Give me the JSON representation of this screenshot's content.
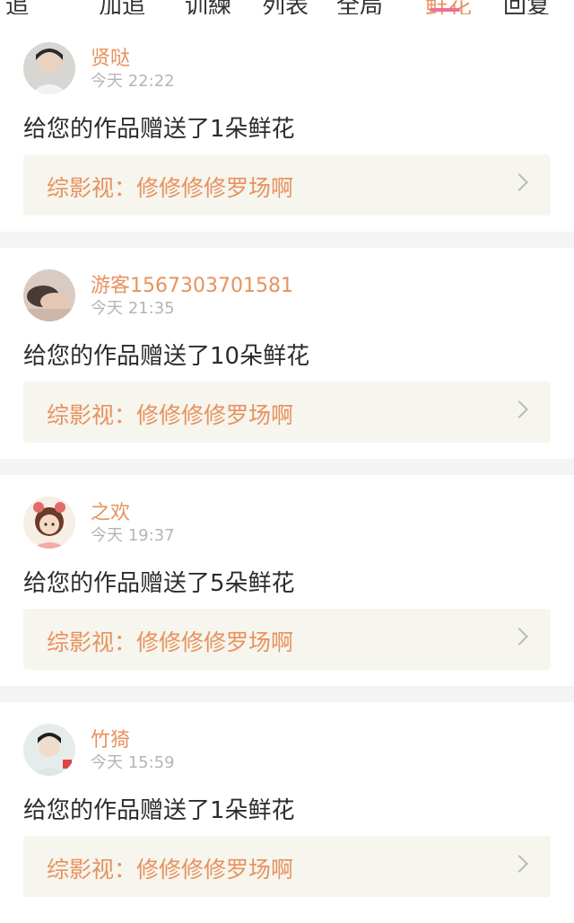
{
  "colors": {
    "accent": "#e8925d",
    "tab_indicator": "#ef6f9a",
    "link_bg": "#f6f5ee",
    "separator": "#f4f4f4",
    "time_gray": "#b5b5b5"
  },
  "tabs": [
    "追",
    "加追",
    "训練",
    "列表",
    "全局",
    "鲜花",
    "回复"
  ],
  "items": [
    {
      "username": "贤哒",
      "time": "今天 22:22",
      "message": "给您的作品赠送了1朵鲜花",
      "work": "综影视：修修修修罗场啊",
      "avatar_icon": "avatar-photo-icon"
    },
    {
      "username": "游客1567303701581",
      "time": "今天 21:35",
      "message": "给您的作品赠送了10朵鲜花",
      "work": "综影视：修修修修罗场啊",
      "avatar_icon": "avatar-photo-icon"
    },
    {
      "username": "之欢",
      "time": "今天 19:37",
      "message": "给您的作品赠送了5朵鲜花",
      "work": "综影视：修修修修罗场啊",
      "avatar_icon": "avatar-illustration-icon"
    },
    {
      "username": "竹猗",
      "time": "今天 15:59",
      "message": "给您的作品赠送了1朵鲜花",
      "work": "综影视：修修修修罗场啊",
      "avatar_icon": "avatar-photo-icon"
    }
  ]
}
